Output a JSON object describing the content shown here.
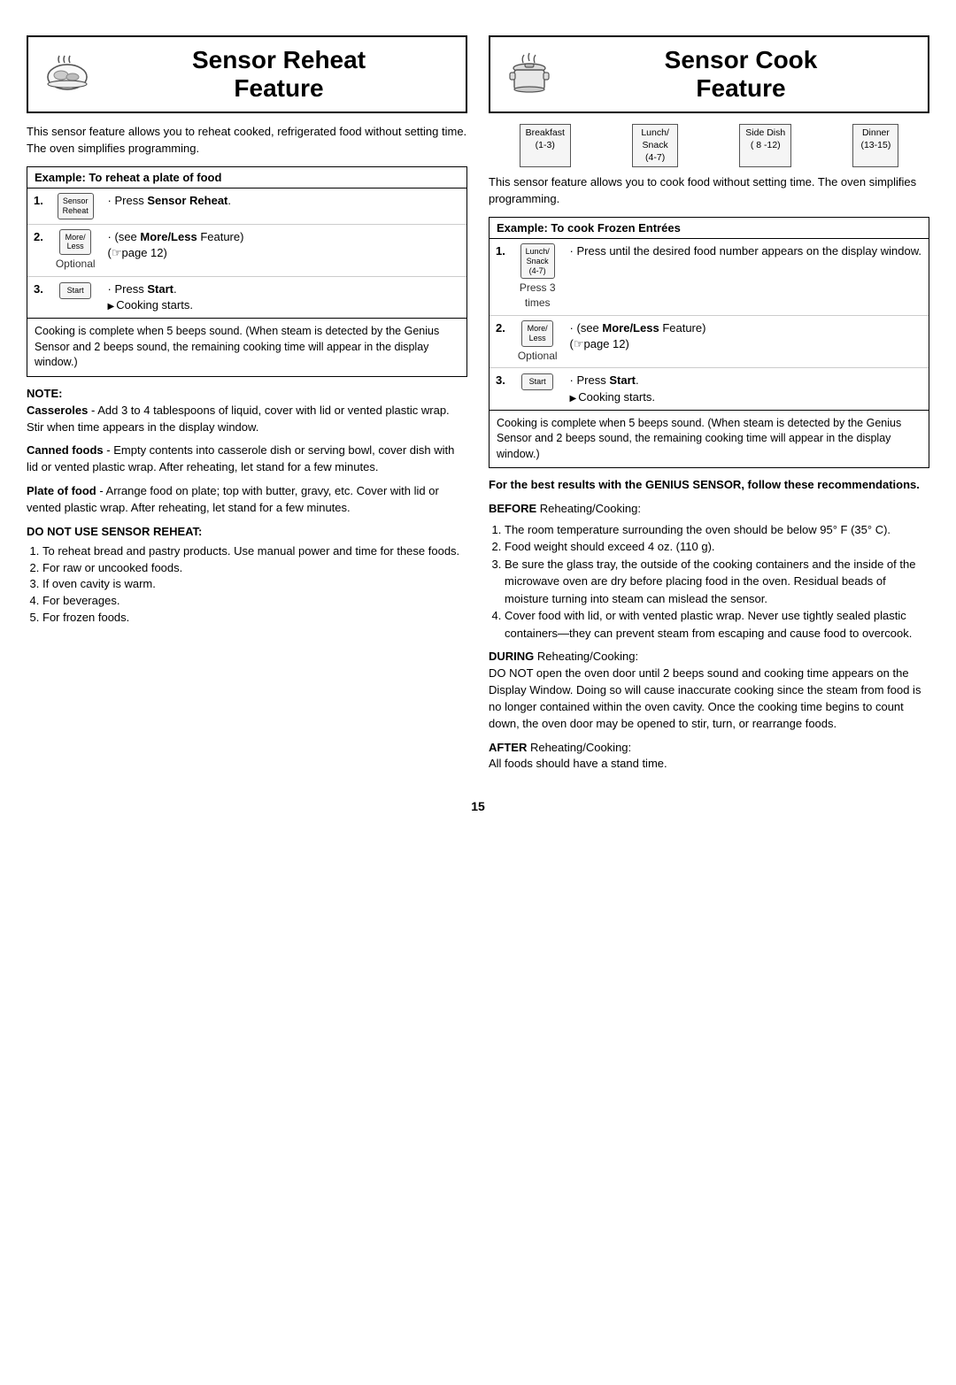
{
  "left": {
    "title_line1": "Sensor Reheat",
    "title_line2": "Feature",
    "intro": "This sensor feature allows you to reheat cooked, refrigerated food without setting time. The oven simplifies programming.",
    "example_title": "Example: To reheat a plate of food",
    "steps": [
      {
        "num": "1.",
        "icon_label": "Sensor\nReheat",
        "desc": "· Press Sensor Reheat."
      },
      {
        "num": "2.",
        "icon_label": "More/\nLess",
        "desc": "· (see More/Less Feature)\n(☞page 12)",
        "optional": "Optional"
      },
      {
        "num": "3.",
        "icon_label": "Start",
        "desc": "· Press Start.\n▶Cooking starts."
      }
    ],
    "cooking_complete": "Cooking is complete when 5 beeps sound. (When steam is detected by the Genius Sensor and 2 beeps sound, the remaining cooking time will appear in the display window.)",
    "note_title": "NOTE:",
    "notes": [
      {
        "bold": "Casseroles",
        "text": " - Add 3 to 4 tablespoons of liquid, cover with lid or vented plastic wrap. Stir when time appears in the display window."
      },
      {
        "bold": "Canned foods",
        "text": " - Empty contents into casserole dish or serving bowl, cover dish with lid or vented plastic wrap. After reheating, let stand for a few minutes."
      },
      {
        "bold": "Plate of food",
        "text": " - Arrange food on plate; top with butter, gravy, etc. Cover with lid or vented plastic wrap. After reheating, let stand for a few minutes."
      }
    ],
    "do_not_title": "DO NOT USE SENSOR REHEAT:",
    "do_not_list": [
      "To reheat bread and pastry products. Use manual power and time for these foods.",
      "For raw or uncooked foods.",
      "If oven cavity is warm.",
      "For beverages.",
      "For frozen foods."
    ]
  },
  "right": {
    "title_line1": "Sensor Cook",
    "title_line2": "Feature",
    "food_cats": [
      {
        "label": "Breakfast",
        "range": "(1-3)"
      },
      {
        "label": "Lunch/\nSnack",
        "range": "(4-7)"
      },
      {
        "label": "Side Dish",
        "range": "( 8 -12)"
      },
      {
        "label": "Dinner",
        "range": "(13-15)"
      }
    ],
    "intro": "This sensor feature allows you to cook food without setting time. The oven simplifies programming.",
    "example_title": "Example: To cook Frozen Entrées",
    "steps": [
      {
        "num": "1.",
        "icon_label": "Lunch/\nSnack\n(4-7)",
        "side_label": "Press 3 times",
        "desc": "· Press until the desired food number appears on the display window."
      },
      {
        "num": "2.",
        "icon_label": "More/\nLess",
        "desc": "· (see More/Less Feature)\n(☞page 12)",
        "optional": "Optional"
      },
      {
        "num": "3.",
        "icon_label": "Start",
        "desc": "· Press Start.\n▶Cooking starts."
      }
    ],
    "cooking_complete": "Cooking is complete when 5 beeps sound. (When steam is detected by the Genius Sensor and 2 beeps sound, the remaining cooking time will appear in the display window.)",
    "best_results_title": "For the best results with the GENIUS SENSOR, follow these recommendations.",
    "before_title": "BEFORE Reheating/Cooking:",
    "before_list": [
      "The room temperature surrounding the oven should be below 95° F (35° C).",
      "Food weight should exceed 4 oz. (110 g).",
      "Be sure the glass tray, the outside of the cooking containers and the inside of the microwave oven are dry before placing food in the oven. Residual beads of moisture turning into steam can mislead the sensor.",
      "Cover food with lid, or with vented plastic wrap. Never use tightly sealed plastic containers—they can prevent steam from escaping and cause food to overcook."
    ],
    "during_title": "DURING Reheating/Cooking:",
    "during_text": "DO NOT open the oven door until 2 beeps sound and cooking time appears on the Display Window. Doing so will cause inaccurate cooking since the steam from food is no longer contained within the oven cavity. Once the cooking time begins to count down, the oven door may be opened to stir, turn, or rearrange foods.",
    "after_title": "AFTER Reheating/Cooking:",
    "after_text": "All foods should have a stand time."
  },
  "page_number": "15"
}
